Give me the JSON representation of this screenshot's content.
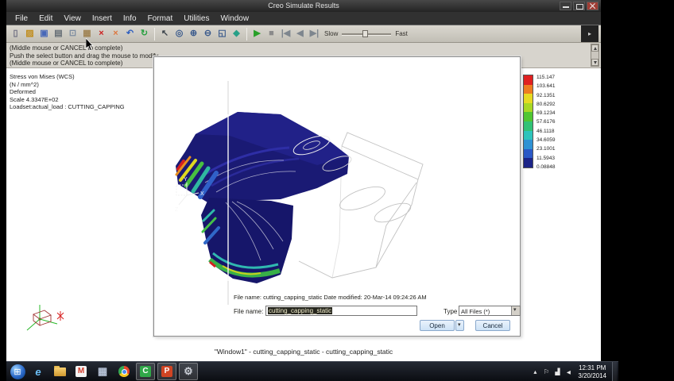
{
  "window": {
    "title": "Creo Simulate Results"
  },
  "menu": {
    "items": [
      "File",
      "Edit",
      "View",
      "Insert",
      "Info",
      "Format",
      "Utilities",
      "Window"
    ]
  },
  "toolbar": {
    "slow_label": "Slow",
    "fast_label": "Fast",
    "icons": [
      {
        "name": "new-file-icon",
        "glyph": "▯",
        "fg": "#6d6d80"
      },
      {
        "name": "open-file-icon",
        "glyph": "▨",
        "fg": "#c08c1c"
      },
      {
        "name": "save-icon",
        "glyph": "▣",
        "fg": "#4868b8"
      },
      {
        "name": "print-icon",
        "glyph": "▤",
        "fg": "#646c74"
      },
      {
        "name": "copy-icon",
        "glyph": "⊡",
        "fg": "#7c8ca0"
      },
      {
        "name": "paste-icon",
        "glyph": "▦",
        "fg": "#a08454"
      },
      {
        "name": "delete-icon",
        "glyph": "×",
        "fg": "#cc2020"
      },
      {
        "name": "erase-icon",
        "glyph": "×",
        "fg": "#dd7840"
      },
      {
        "name": "undo-icon",
        "glyph": "↶",
        "fg": "#3060c0"
      },
      {
        "name": "refresh-icon",
        "glyph": "↻",
        "fg": "#28a040"
      },
      {
        "sep": true
      },
      {
        "name": "select-arrow-icon",
        "glyph": "↖",
        "fg": "#3c444c"
      },
      {
        "name": "zoom-box-icon",
        "glyph": "◎",
        "fg": "#3a5a8c"
      },
      {
        "name": "zoom-in-icon",
        "glyph": "⊕",
        "fg": "#3a5a8c"
      },
      {
        "name": "zoom-out-icon",
        "glyph": "⊖",
        "fg": "#3a5a8c"
      },
      {
        "name": "refit-icon",
        "glyph": "◱",
        "fg": "#3a5a8c"
      },
      {
        "name": "repaint-icon",
        "glyph": "◆",
        "fg": "#28a088"
      },
      {
        "sep": true
      },
      {
        "name": "play-icon",
        "glyph": "▶",
        "fg": "#28a028"
      },
      {
        "name": "stop-icon",
        "glyph": "■",
        "fg": "#8a8a8a"
      },
      {
        "name": "first-frame-icon",
        "glyph": "|◀",
        "fg": "#7e868e"
      },
      {
        "name": "prev-frame-icon",
        "glyph": "◀",
        "fg": "#7e868e"
      },
      {
        "name": "next-frame-icon",
        "glyph": "▶|",
        "fg": "#7e868e"
      }
    ]
  },
  "messages": {
    "lines": [
      "(Middle mouse or CANCEL to complete)",
      "Push the select button and drag the mouse to modify",
      "(Middle mouse or CANCEL to complete)"
    ]
  },
  "result_info": {
    "lines": [
      "Stress von Mises (WCS)",
      "(N / mm^2)",
      "Deformed",
      "Scale  4.3347E+02",
      "Loadset:actual_load : CUTTING_CAPPING"
    ]
  },
  "legend": {
    "values": [
      "115.147",
      "103.641",
      "92.1351",
      "80.6292",
      "69.1234",
      "57.6176",
      "46.1118",
      "34.6059",
      "23.1001",
      "11.5943",
      "0.08848"
    ],
    "colors": [
      "#e02020",
      "#ee7c20",
      "#e6da22",
      "#a8d824",
      "#50c632",
      "#32c276",
      "#2ec4bc",
      "#2f92d4",
      "#2a58c6",
      "#1c2488"
    ]
  },
  "dialog": {
    "info_line": "File name: cutting_capping_static  Date modified: 20-Mar-14 09:24:26 AM",
    "file_name_label": "File name:",
    "file_name_value": "cutting_capping_static",
    "type_label": "Type",
    "type_value": "All Files (*)",
    "open_label": "Open",
    "cancel_label": "Cancel"
  },
  "viewport": {
    "caption": "\"Window1\" - cutting_capping_static - cutting_capping_static"
  },
  "taskbar": {
    "time": "12:31 PM",
    "date": "3/20/2014",
    "apps": [
      {
        "name": "start-button",
        "kind": "start",
        "glyph": "⊞",
        "active": false
      },
      {
        "name": "internet-explorer-icon",
        "kind": "app",
        "glyph": "e",
        "fg": "#6cc0f8",
        "italic": true,
        "active": false
      },
      {
        "name": "folder-explorer-icon",
        "kind": "folder",
        "active": false
      },
      {
        "name": "gmail-icon",
        "kind": "badge",
        "glyph": "M",
        "fg": "#d43c2c",
        "bg": "#f4f4f4",
        "active": false
      },
      {
        "name": "media-app-icon",
        "kind": "app",
        "glyph": "▦",
        "fg": "#b8c4d8",
        "active": false
      },
      {
        "name": "chrome-icon",
        "kind": "chrome",
        "active": false
      },
      {
        "name": "creo-app-icon",
        "kind": "badge",
        "glyph": "C",
        "fg": "#ffffff",
        "bg": "#30a848",
        "active": true
      },
      {
        "name": "powerpoint-icon",
        "kind": "badge",
        "glyph": "P",
        "fg": "#ffffff",
        "bg": "#d04423",
        "active": true
      },
      {
        "name": "settings-gear-icon",
        "kind": "app",
        "glyph": "⚙",
        "fg": "#c8ccd4",
        "active": true
      }
    ]
  }
}
